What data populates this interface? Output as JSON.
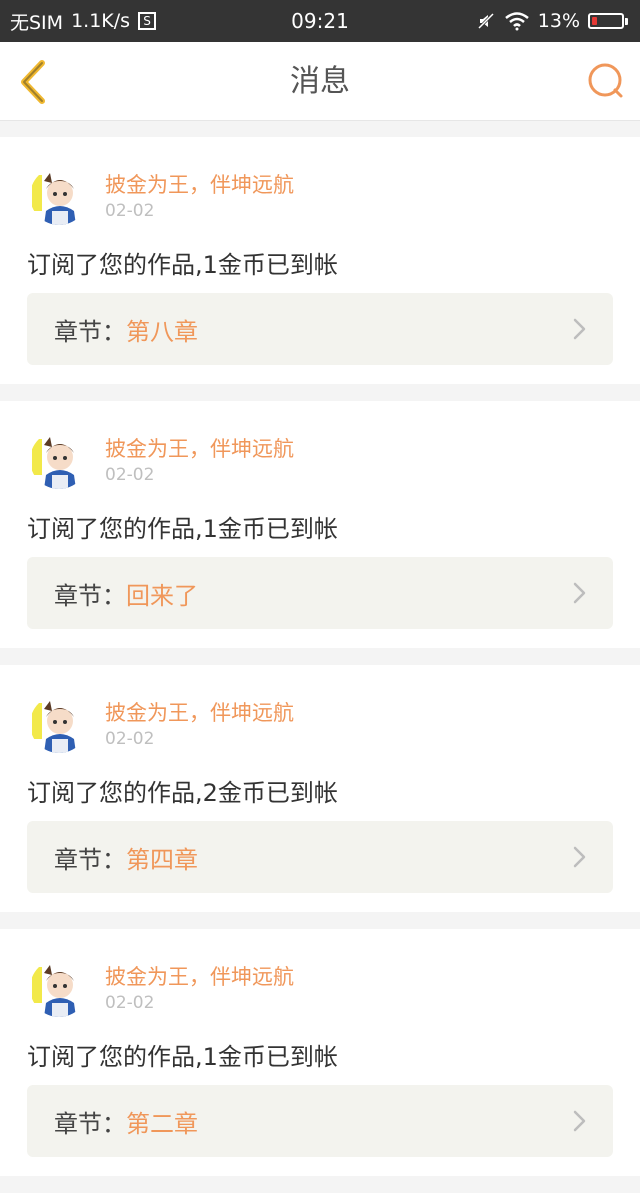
{
  "status_bar": {
    "carrier": "无SIM",
    "speed": "1.1K/s",
    "sim_icon_glyph": "S",
    "time": "09:21",
    "battery": "13%",
    "battery_level": 0.13
  },
  "nav": {
    "title": "消息",
    "accent_color": "#f0975a"
  },
  "messages": [
    {
      "sender": "披金为王，伴坤远航",
      "date": "02-02",
      "text": "订阅了您的作品,1金币已到帐",
      "chapter_label": "章节：",
      "chapter_name": "第八章"
    },
    {
      "sender": "披金为王，伴坤远航",
      "date": "02-02",
      "text": "订阅了您的作品,1金币已到帐",
      "chapter_label": "章节：",
      "chapter_name": "回来了"
    },
    {
      "sender": "披金为王，伴坤远航",
      "date": "02-02",
      "text": "订阅了您的作品,2金币已到帐",
      "chapter_label": "章节：",
      "chapter_name": "第四章"
    },
    {
      "sender": "披金为王，伴坤远航",
      "date": "02-02",
      "text": "订阅了您的作品,1金币已到帐",
      "chapter_label": "章节：",
      "chapter_name": "第二章"
    }
  ]
}
